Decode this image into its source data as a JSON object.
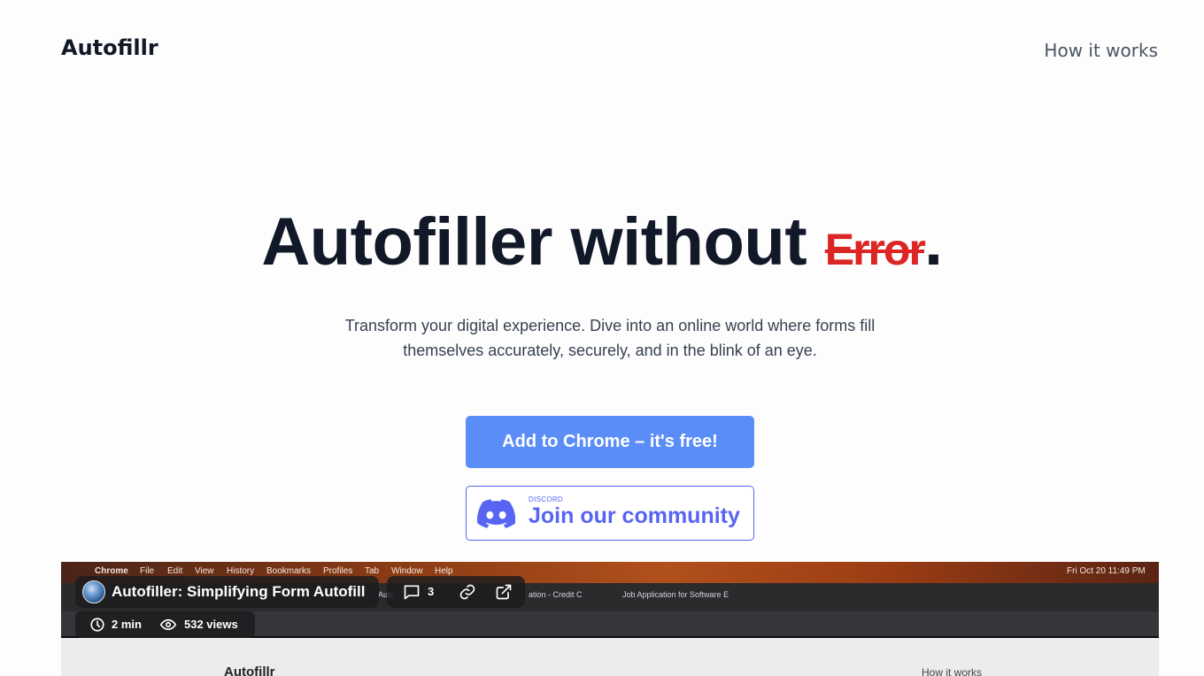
{
  "header": {
    "logo": "Autofillr",
    "nav_link": "How it works"
  },
  "hero": {
    "title_main": "Autofiller without ",
    "title_struck": "Error",
    "title_end": ".",
    "subtitle_line1": "Transform your digital experience. Dive into an online world where forms fill",
    "subtitle_line2": "themselves accurately, securely, and in the blink of an eye."
  },
  "cta": {
    "primary_label": "Add to Chrome – it's free!",
    "discord_small": "DISCORD",
    "discord_label": "Join our community"
  },
  "video": {
    "title": "Autofiller: Simplifying Form Autofill",
    "comment_count": "3",
    "duration": "2 min",
    "views": "532 views",
    "mac_menu": [
      "Chrome",
      "File",
      "Edit",
      "View",
      "History",
      "Bookmarks",
      "Profiles",
      "Tab",
      "Window",
      "Help"
    ],
    "mac_clock": "Fri Oct 20  11:49 PM",
    "tabs": [
      "Autc",
      "ation - Credit C",
      "Job Application for Software E"
    ],
    "inner_logo": "Autofillr",
    "inner_nav": "How it works"
  },
  "colors": {
    "accent_blue": "#5b8df8",
    "discord": "#5865f2",
    "error_red": "#dc2626"
  },
  "icons": [
    "discord-icon",
    "comment-icon",
    "link-icon",
    "external-link-icon",
    "clock-icon",
    "eye-icon"
  ]
}
